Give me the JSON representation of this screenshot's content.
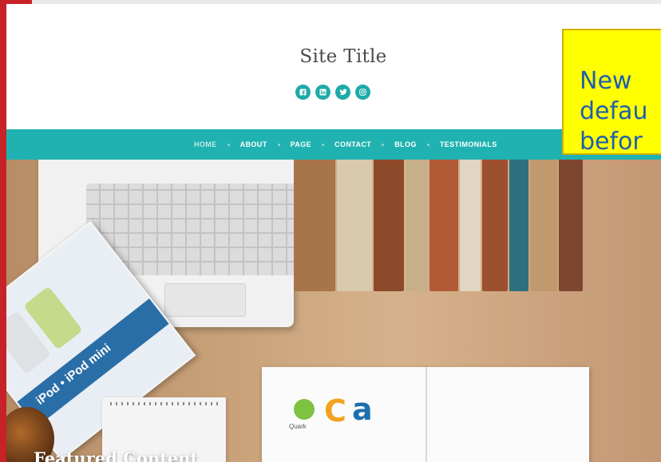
{
  "site": {
    "title": "Site Title"
  },
  "social_icons": [
    {
      "name": "facebook-icon"
    },
    {
      "name": "linkedin-icon"
    },
    {
      "name": "twitter-icon"
    },
    {
      "name": "instagram-icon"
    }
  ],
  "nav": {
    "items": [
      {
        "label": "HOME",
        "active": true
      },
      {
        "label": "ABOUT",
        "active": false
      },
      {
        "label": "PAGE",
        "active": false
      },
      {
        "label": "CONTACT",
        "active": false
      },
      {
        "label": "BLOG",
        "active": false
      },
      {
        "label": "TESTIMONIALS",
        "active": false
      }
    ]
  },
  "hero": {
    "featured_title": "Featured Content",
    "magazine_text": "iPod • iPod mini",
    "book_logo_label": "Quark"
  },
  "callout": {
    "text": "New\ndefau\nbefor"
  },
  "colors": {
    "accent": "#20b2b0",
    "frame": "#c62227",
    "callout_bg": "#ffff00",
    "callout_text": "#1e5fae"
  }
}
